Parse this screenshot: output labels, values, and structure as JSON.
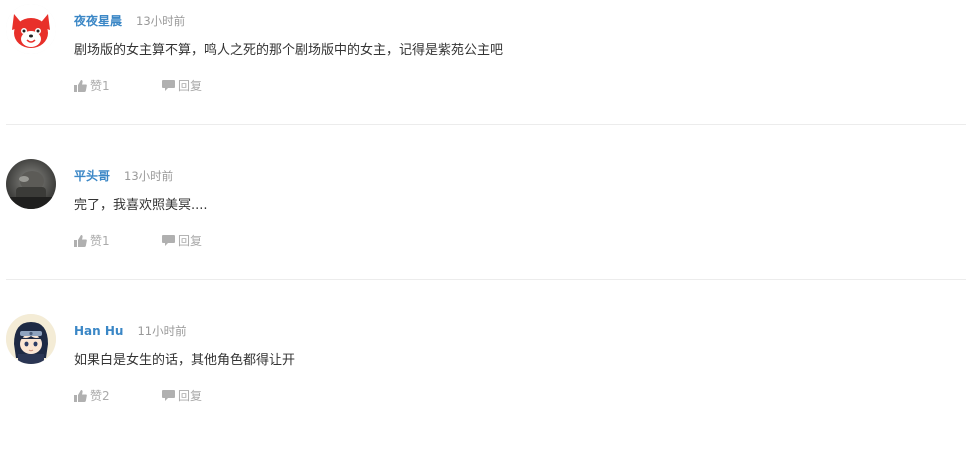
{
  "comments": [
    {
      "author": "夜夜星晨",
      "time": "13小时前",
      "content": "剧场版的女主算不算，鸣人之死的那个剧场版中的女主，记得是紫苑公主吧",
      "like_label": "赞1",
      "reply_label": "回复",
      "avatar_icon": "red-fox-avatar-icon"
    },
    {
      "author": "平头哥",
      "time": "13小时前",
      "content": "完了，我喜欢照美冥....",
      "like_label": "赞1",
      "reply_label": "回复",
      "avatar_icon": "dark-photo-avatar-icon"
    },
    {
      "author": "Han Hu",
      "time": "11小时前",
      "content": "如果白是女生的话，其他角色都得让开",
      "like_label": "赞2",
      "reply_label": "回复",
      "avatar_icon": "anime-ninja-avatar-icon"
    }
  ],
  "colors": {
    "author": "#3b87c6",
    "time": "#999999",
    "content": "#333333",
    "action": "#aaaaaa",
    "divider": "#ececec"
  }
}
